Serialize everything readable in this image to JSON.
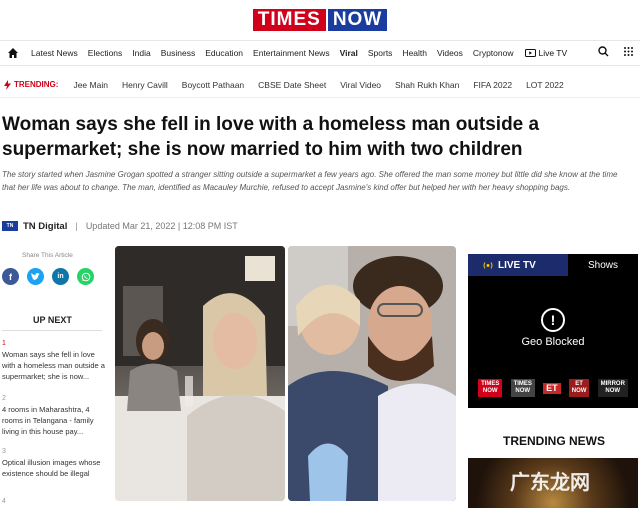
{
  "brand": {
    "logo_times": "TIMES",
    "logo_now": "NOW"
  },
  "nav": {
    "items": [
      "Latest News",
      "Elections",
      "India",
      "Business",
      "Education",
      "Entertainment News",
      "Viral",
      "Sports",
      "Health",
      "Videos",
      "Cryptonow"
    ],
    "live_tv": "Live TV"
  },
  "trending": {
    "label": "TRENDING:",
    "items": [
      "Jee Main",
      "Henry Cavill",
      "Boycott Pathaan",
      "CBSE Date Sheet",
      "Viral Video",
      "Shah Rukh Khan",
      "FIFA 2022",
      "LOT 2022"
    ]
  },
  "article": {
    "headline": "Woman says she fell in love with a homeless man outside a supermarket; she is now married to him with two children",
    "summary": "The story started when Jasmine Grogan spotted a stranger sitting outside a supermarket a few years ago. She offered the man some money but little did she know at the time that her life was about to change. The man, identified as Macauley Murchie, refused to accept Jasmine's kind offer but helped her with her heavy shopping bags.",
    "author_logo": "TN",
    "author": "TN Digital",
    "updated": "Updated Mar 21, 2022 | 12:08 PM IST"
  },
  "share": {
    "label": "Share This Article"
  },
  "upnext": {
    "title": "UP NEXT",
    "items": [
      {
        "num": "1",
        "text": "Woman says she fell in love with a homeless man outside a supermarket; she is now..."
      },
      {
        "num": "2",
        "text": "4 rooms in Maharashtra, 4 rooms in Telangana - family living in this house pay..."
      },
      {
        "num": "3",
        "text": "Optical illusion images whose existence should be illegal"
      },
      {
        "num": "4",
        "text": ""
      }
    ]
  },
  "livetv": {
    "title": "LIVE TV",
    "shows": "Shows",
    "geo_icon": "!",
    "geo_text": "Geo Blocked",
    "channels": {
      "times_now_1": "TIMES",
      "times_now_2": "NOW",
      "tnow_1": "TIMES",
      "tnow_2": "NOW",
      "et": "ET",
      "etnow_1": "ET",
      "etnow_2": "NOW",
      "mirror_1": "MIRROR",
      "mirror_2": "NOW"
    }
  },
  "trending_news": {
    "title": "TRENDING NEWS"
  },
  "watermark": {
    "text": "广东龙网"
  }
}
